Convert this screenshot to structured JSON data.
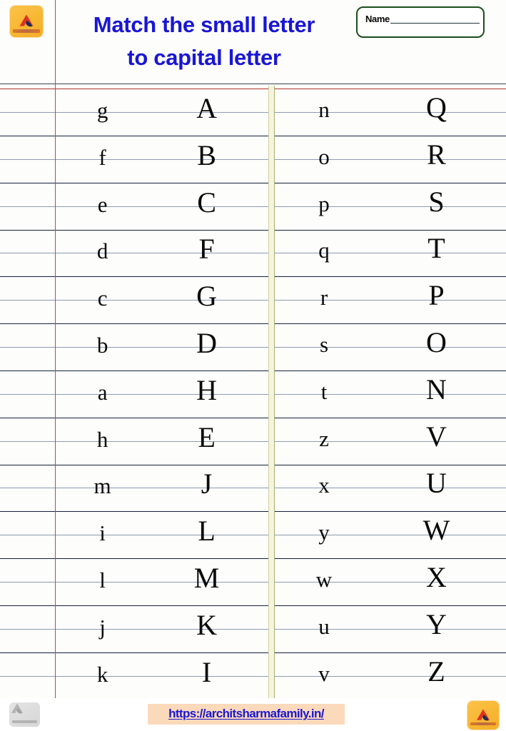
{
  "header": {
    "title_line1": "Match the small letter",
    "title_line2": "to capital letter",
    "title_color": "#1a16d4",
    "name_label": "Name",
    "name_value": "",
    "logo_icon": "brand-logo-icon"
  },
  "worksheet": {
    "left_column": [
      {
        "small": "g",
        "capital": "A"
      },
      {
        "small": "f",
        "capital": "B"
      },
      {
        "small": "e",
        "capital": "C"
      },
      {
        "small": "d",
        "capital": "F"
      },
      {
        "small": "c",
        "capital": "G"
      },
      {
        "small": "b",
        "capital": "D"
      },
      {
        "small": "a",
        "capital": "H"
      },
      {
        "small": "h",
        "capital": "E"
      },
      {
        "small": "m",
        "capital": "J"
      },
      {
        "small": "i",
        "capital": "L"
      },
      {
        "small": "l",
        "capital": "M"
      },
      {
        "small": "j",
        "capital": "K"
      },
      {
        "small": "k",
        "capital": "I"
      }
    ],
    "right_column": [
      {
        "small": "n",
        "capital": "Q"
      },
      {
        "small": "o",
        "capital": "R"
      },
      {
        "small": "p",
        "capital": "S"
      },
      {
        "small": "q",
        "capital": "T"
      },
      {
        "small": "r",
        "capital": "P"
      },
      {
        "small": "s",
        "capital": "O"
      },
      {
        "small": "t",
        "capital": "N"
      },
      {
        "small": "z",
        "capital": "V"
      },
      {
        "small": "x",
        "capital": "U"
      },
      {
        "small": "y",
        "capital": "W"
      },
      {
        "small": "w",
        "capital": "X"
      },
      {
        "small": "u",
        "capital": "Y"
      },
      {
        "small": "v",
        "capital": "Z"
      }
    ]
  },
  "footer": {
    "url": "https://architsharmafamily.in/",
    "url_color": "#1a16d4",
    "url_highlight": "#fbd9bb",
    "logo_left_icon": "brand-logo-grey-icon",
    "logo_right_icon": "brand-logo-icon"
  },
  "paper": {
    "margin_line_color": "#b5485a",
    "rule_dark_color": "#15223c",
    "rule_light_color": "#8d9bb0",
    "divider_color": "#f6f4dd"
  }
}
